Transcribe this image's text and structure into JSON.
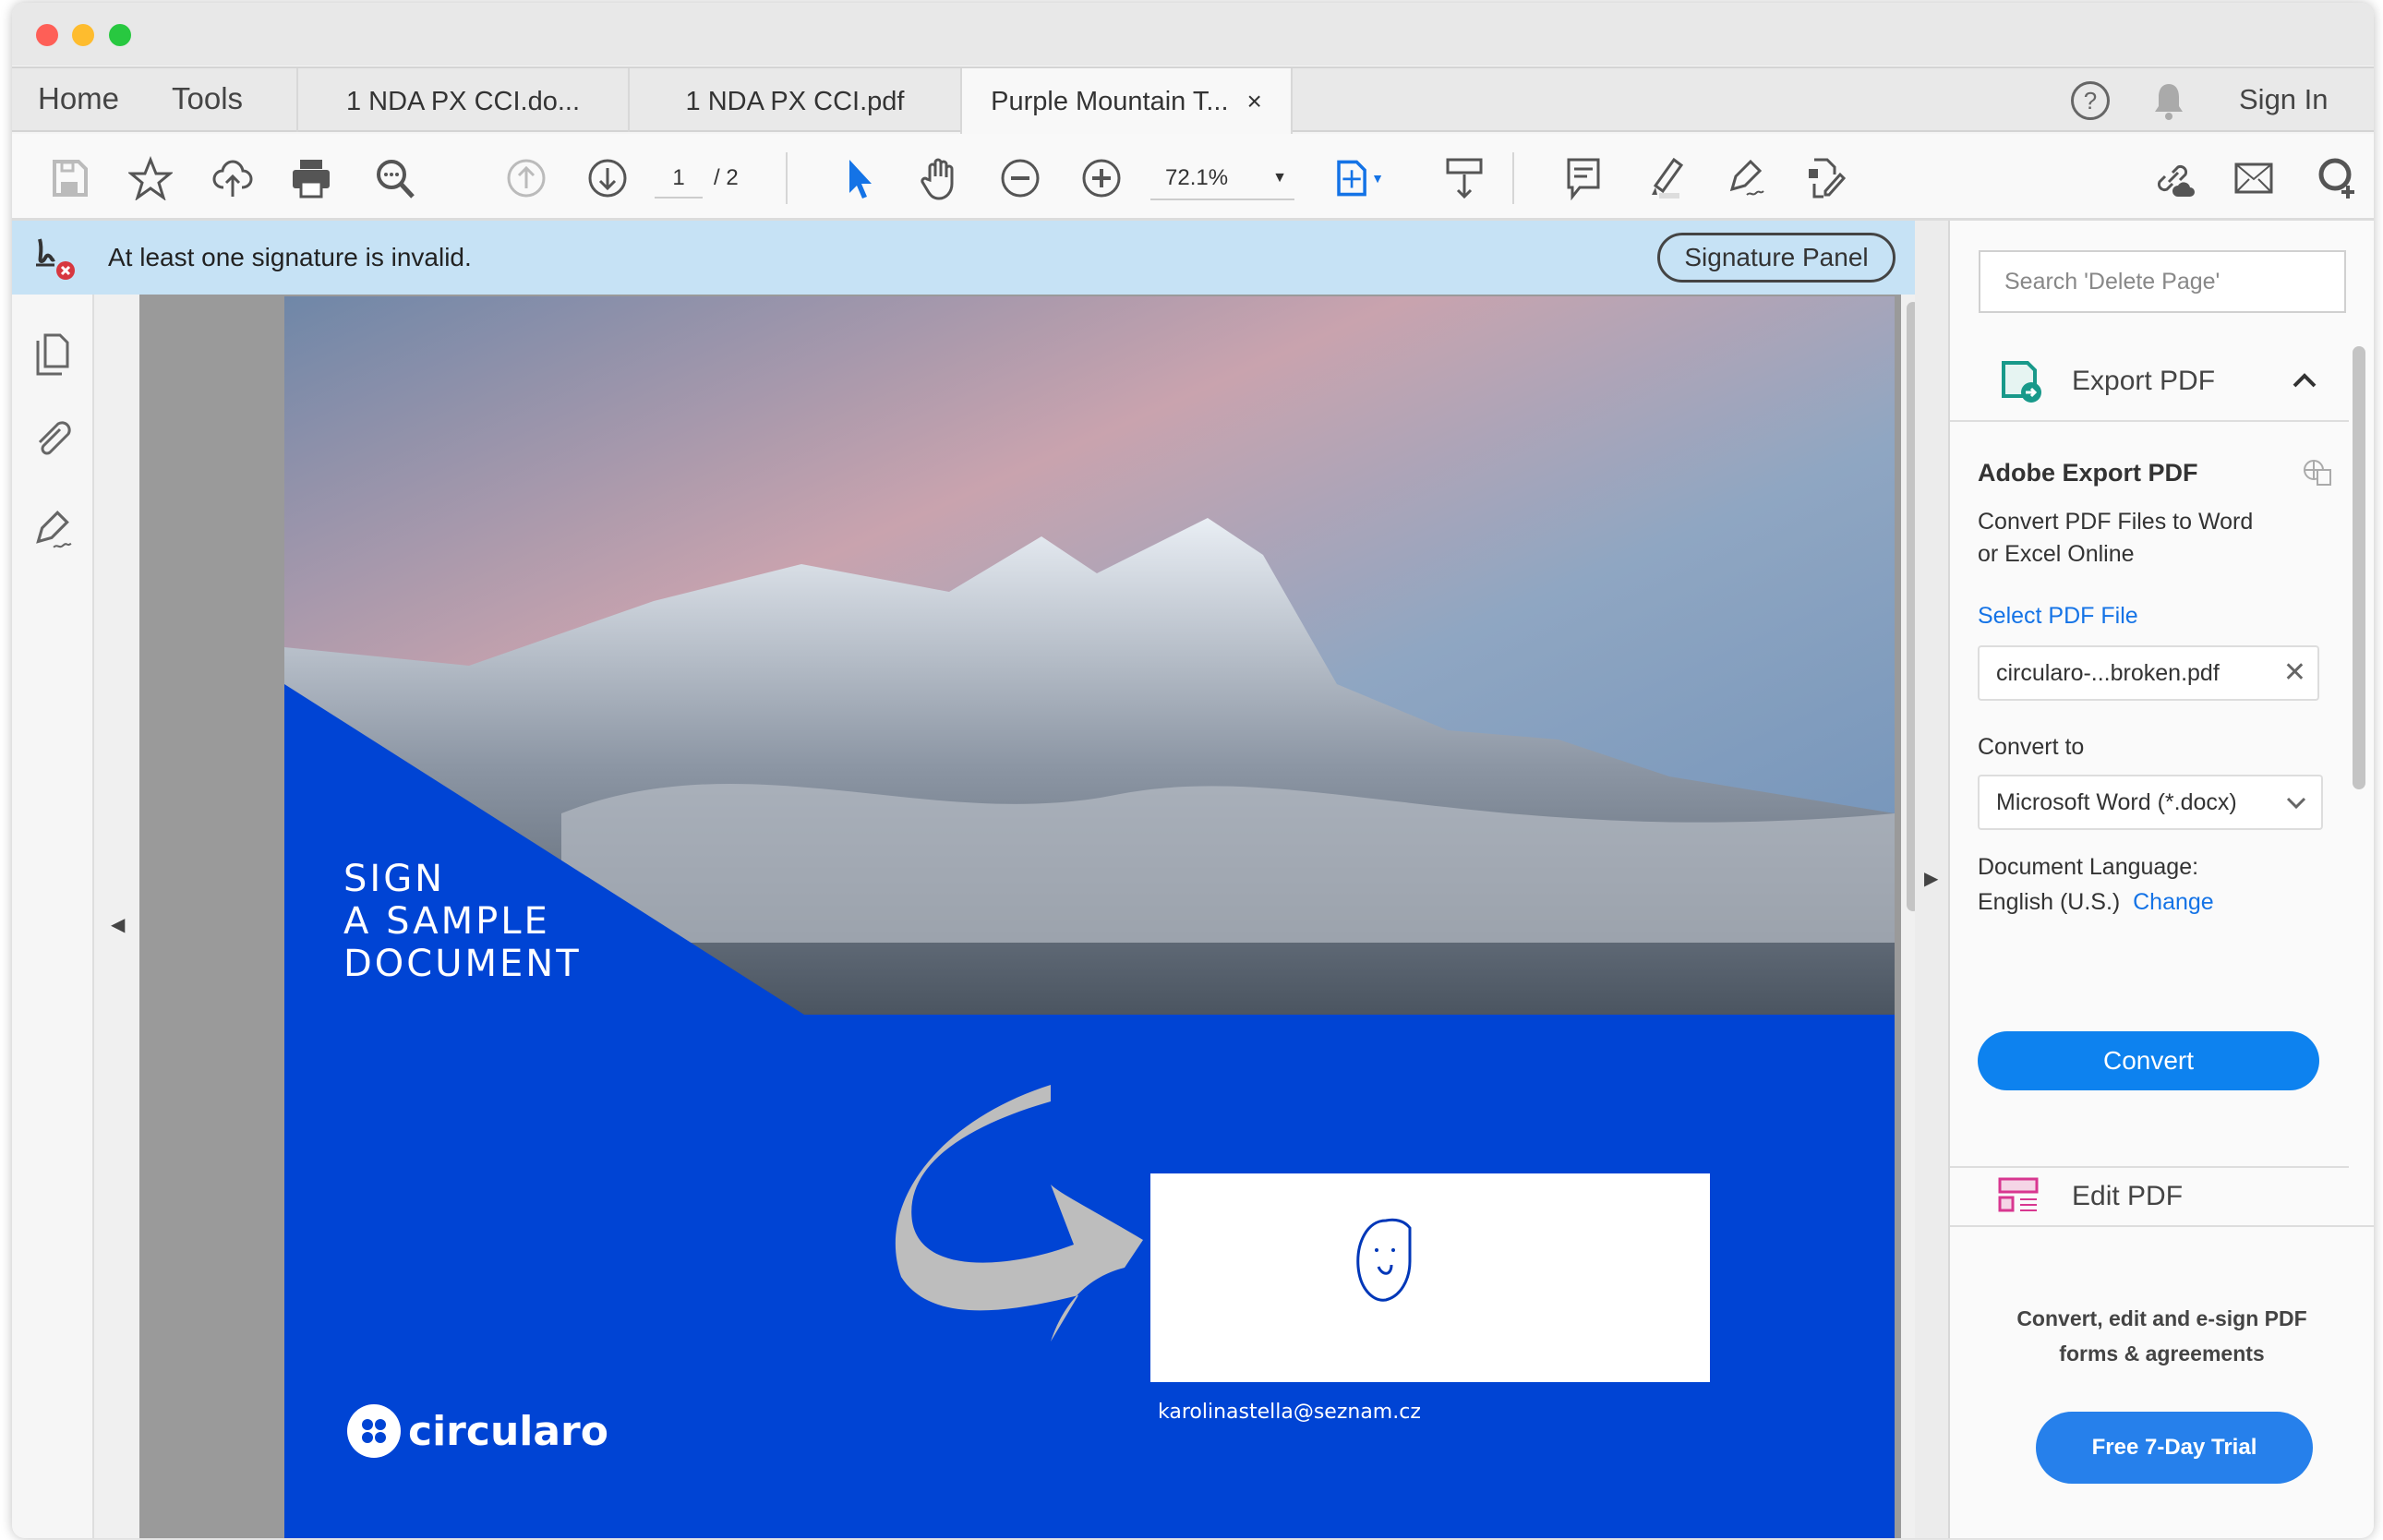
{
  "window": {
    "traffic_lights": [
      "#fe5f57",
      "#febc2e",
      "#28c840"
    ]
  },
  "nav": {
    "home": "Home",
    "tools": "Tools"
  },
  "tabs": [
    {
      "label": "1 NDA PX CCI.do..."
    },
    {
      "label": "1 NDA PX CCI.pdf"
    },
    {
      "label": "Purple Mountain T...",
      "active": true,
      "close": "×"
    }
  ],
  "header_right": {
    "sign_in": "Sign In",
    "help": "?"
  },
  "toolbar": {
    "page_current": "1",
    "page_total": "/ 2",
    "zoom": "72.1%",
    "accent": "#1473e6"
  },
  "alert": {
    "message": "At least one signature is invalid.",
    "button": "Signature Panel",
    "bg": "#c6e2f5"
  },
  "document": {
    "headline": [
      "SIGN",
      "A SAMPLE",
      "DOCUMENT"
    ],
    "brand": "circularo",
    "signer_email": "karolinastella@seznam.cz",
    "brand_color": "#0044d4"
  },
  "right_panel": {
    "search_placeholder": "Search 'Delete Page'",
    "export_header": "Export PDF",
    "section_title": "Adobe Export PDF",
    "description_1": "Convert PDF Files to Word",
    "description_2": "or Excel Online",
    "select_file": "Select PDF File",
    "file_name": "circularo-...broken.pdf",
    "convert_to_label": "Convert to",
    "convert_to_value": "Microsoft Word (*.docx)",
    "language_label": "Document Language:",
    "language_value": "English (U.S.)",
    "change_link": "Change",
    "convert_button": "Convert",
    "edit_header": "Edit PDF",
    "promo_1": "Convert, edit and e-sign PDF",
    "promo_2": "forms & agreements",
    "trial_button": "Free 7-Day Trial"
  }
}
